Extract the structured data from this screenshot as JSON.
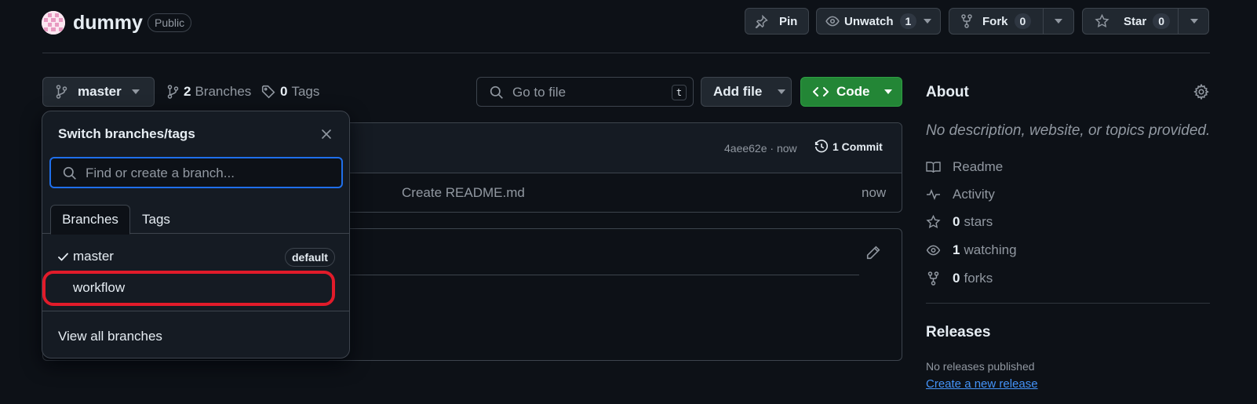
{
  "repo": {
    "name": "dummy",
    "visibility": "Public"
  },
  "header_actions": {
    "pin_label": "Pin",
    "unwatch_label": "Unwatch",
    "watch_count": "1",
    "fork_label": "Fork",
    "fork_count": "0",
    "star_label": "Star",
    "star_count": "0"
  },
  "toolbar": {
    "branch_name": "master",
    "branches_count": "2",
    "branches_label": "Branches",
    "tags_count": "0",
    "tags_label": "Tags",
    "goto_placeholder": "Go to file",
    "goto_shortcut": "t",
    "add_file_label": "Add file",
    "code_label": "Code"
  },
  "files": {
    "commit_hash_time": "4aee62e · now",
    "commit_count_label": "1 Commit",
    "rows": [
      {
        "message": "Create README.md",
        "time": "now"
      }
    ]
  },
  "about": {
    "title": "About",
    "description": "No description, website, or topics provided.",
    "items": [
      {
        "icon": "book-icon",
        "label": "Readme"
      },
      {
        "icon": "pulse-icon",
        "label": "Activity"
      },
      {
        "icon": "star-icon",
        "count": "0",
        "label": "stars"
      },
      {
        "icon": "eye-icon",
        "count": "1",
        "label": "watching"
      },
      {
        "icon": "fork-icon",
        "count": "0",
        "label": "forks"
      }
    ]
  },
  "releases": {
    "title": "Releases",
    "empty_text": "No releases published",
    "create_link": "Create a new release"
  },
  "branch_dropdown": {
    "title": "Switch branches/tags",
    "search_placeholder": "Find or create a branch...",
    "tabs": [
      "Branches",
      "Tags"
    ],
    "branches": [
      {
        "name": "master",
        "selected": true,
        "badge": "default"
      },
      {
        "name": "workflow",
        "selected": false
      }
    ],
    "view_all_label": "View all branches"
  },
  "colors": {
    "background": "#0d1117",
    "accent_green": "#238636",
    "focus_blue": "#1f6feb",
    "link_blue": "#4493f8",
    "highlight_red": "#e11b2a"
  }
}
